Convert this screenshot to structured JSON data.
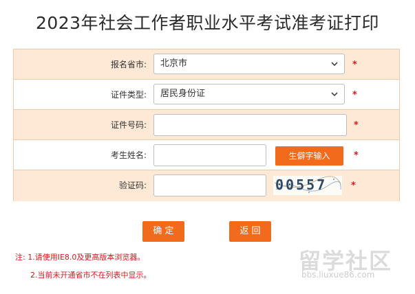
{
  "page": {
    "title": "2023年社会工作者职业水平考试准考证打印"
  },
  "form": {
    "city": {
      "label": "报名省市:",
      "value": "北京市",
      "required_mark": "*"
    },
    "id_type": {
      "label": "证件类型:",
      "value": "居民身份证",
      "required_mark": "*"
    },
    "id_number": {
      "label": "证件号码:",
      "value": "",
      "required_mark": "*"
    },
    "name": {
      "label": "考生姓名:",
      "value": "",
      "button_label": "生僻字输入",
      "required_mark": "*"
    },
    "captcha": {
      "label": "验证码:",
      "value": "",
      "code": "00557",
      "required_mark": "*"
    }
  },
  "actions": {
    "confirm_label": "确 定",
    "back_label": "返 回"
  },
  "notes": {
    "line1": "注: 1.请使用IE8.0及更高版本浏览器。",
    "line2": "2.当前未开通省市不在列表中显示。"
  },
  "watermark": {
    "title": "留学社区",
    "url": "bbs.liuxue86.com"
  },
  "colors": {
    "accent": "#f26a1b",
    "row_tint": "#fde9d5",
    "border": "#f0c9a6",
    "required": "#e0181e",
    "note_text": "#d8141e"
  },
  "icons": {
    "select_arrow": "chevron-down-icon"
  }
}
